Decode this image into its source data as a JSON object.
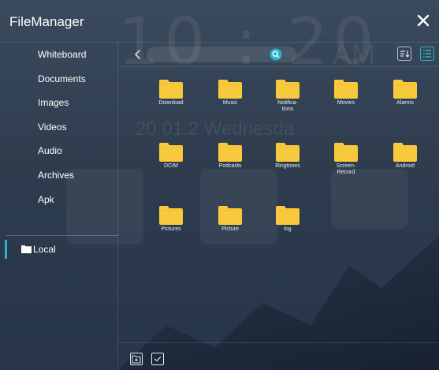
{
  "app": {
    "title": "FileManager"
  },
  "background": {
    "clock_digits": "10 : 20",
    "ampm": "AM",
    "date_partial": "20  01.2 Wednesda"
  },
  "sidebar": {
    "items": [
      {
        "label": "Whiteboard"
      },
      {
        "label": "Documents"
      },
      {
        "label": "Images"
      },
      {
        "label": "Videos"
      },
      {
        "label": "Audio"
      },
      {
        "label": "Archives"
      },
      {
        "label": "Apk"
      }
    ],
    "local": {
      "label": "Local",
      "selected": true
    }
  },
  "toolbar": {
    "search": {
      "value": "",
      "placeholder": ""
    },
    "icons": [
      "back-chevron",
      "search",
      "sort",
      "list-view"
    ]
  },
  "folders": [
    {
      "name": "Download"
    },
    {
      "name": "Music"
    },
    {
      "name": "Notifica-\ntions"
    },
    {
      "name": "Movies"
    },
    {
      "name": "Alarms"
    },
    {
      "name": "DCIM"
    },
    {
      "name": "Podcasts"
    },
    {
      "name": "Ringtones"
    },
    {
      "name": "Screen-\nRecord"
    },
    {
      "name": "Android"
    },
    {
      "name": "Pictures"
    },
    {
      "name": "Picture"
    },
    {
      "name": "log"
    }
  ],
  "bottombar": {
    "icons": [
      "new-folder",
      "select-all-checkbox"
    ]
  },
  "colors": {
    "accent": "#27b6c8",
    "folder": "#f7c93c",
    "folder_tab": "#f2b92a",
    "active_view": "#27b6c8"
  }
}
